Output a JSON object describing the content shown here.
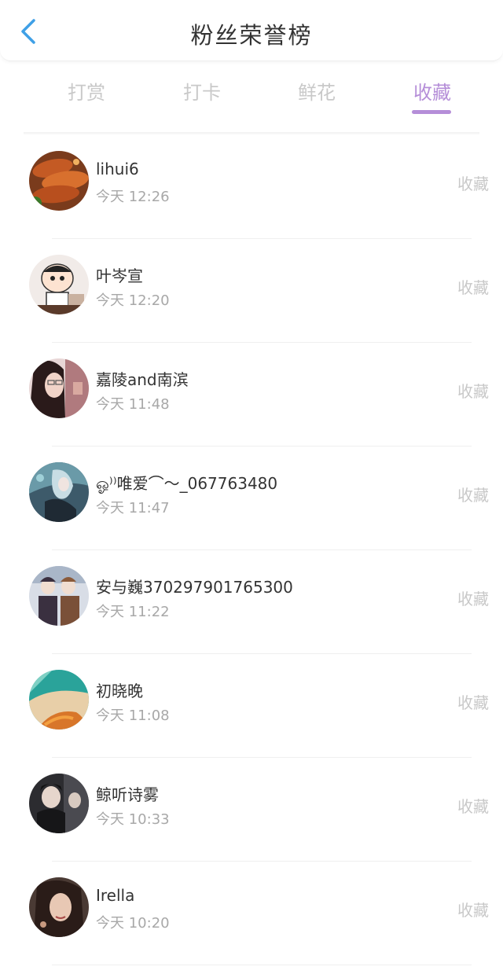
{
  "header": {
    "title": "粉丝荣誉榜",
    "back_icon": "chevron-left-icon"
  },
  "tabs": [
    {
      "label": "打赏",
      "active": false
    },
    {
      "label": "打卡",
      "active": false
    },
    {
      "label": "鲜花",
      "active": false
    },
    {
      "label": "收藏",
      "active": true
    }
  ],
  "colors": {
    "accent": "#b58ed8",
    "back": "#3fa0e6"
  },
  "list": [
    {
      "name": "lihui6",
      "time": "今天 12:26",
      "action": "收藏"
    },
    {
      "name": "叶岑宣",
      "time": "今天 12:20",
      "action": "收藏"
    },
    {
      "name": "嘉陵and南滨",
      "time": "今天 11:48",
      "action": "收藏"
    },
    {
      "name": "ஓ⁾⁾唯爱⌒～_067763480",
      "time": "今天 11:47",
      "action": "收藏"
    },
    {
      "name": "安与巍370297901765300",
      "time": "今天 11:22",
      "action": "收藏"
    },
    {
      "name": "初晓晚",
      "time": "今天 11:08",
      "action": "收藏"
    },
    {
      "name": "鲸听诗雾",
      "time": "今天 10:33",
      "action": "收藏"
    },
    {
      "name": "Irella",
      "time": "今天 10:20",
      "action": "收藏"
    }
  ]
}
